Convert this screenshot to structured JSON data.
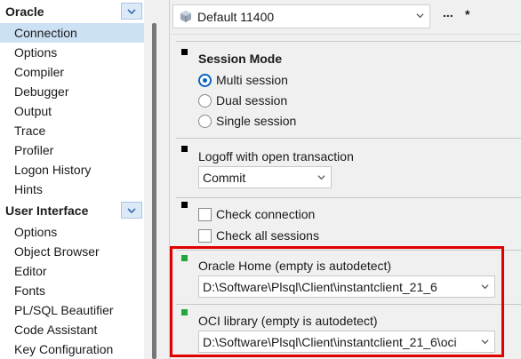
{
  "nav": {
    "groups": [
      {
        "label": "Oracle",
        "items": [
          "Connection",
          "Options",
          "Compiler",
          "Debugger",
          "Output",
          "Trace",
          "Profiler",
          "Logon History",
          "Hints"
        ]
      },
      {
        "label": "User Interface",
        "items": [
          "Options",
          "Object Browser",
          "Editor",
          "Fonts",
          "PL/SQL Beautifier",
          "Code Assistant",
          "Key Configuration"
        ]
      }
    ],
    "selected": "Connection"
  },
  "profile": {
    "value": "Default 11400",
    "more_label": "...",
    "modified_marker": "*"
  },
  "session_mode": {
    "title": "Session Mode",
    "options": [
      "Multi session",
      "Dual session",
      "Single session"
    ],
    "selected": "Multi session"
  },
  "logoff": {
    "label": "Logoff with open transaction",
    "value": "Commit"
  },
  "checks": {
    "check_connection": "Check connection",
    "check_all_sessions": "Check all sessions"
  },
  "oracle_home": {
    "label": "Oracle Home (empty is autodetect)",
    "value": "D:\\Software\\Plsql\\Client\\instantclient_21_6"
  },
  "oci_library": {
    "label": "OCI library (empty is autodetect)",
    "value": "D:\\Software\\Plsql\\Client\\instantclient_21_6\\oci"
  },
  "colors": {
    "accent": "#0b63c4",
    "selection": "#cde1f5",
    "highlight_border": "#e00000",
    "status_green": "#22a83a"
  }
}
